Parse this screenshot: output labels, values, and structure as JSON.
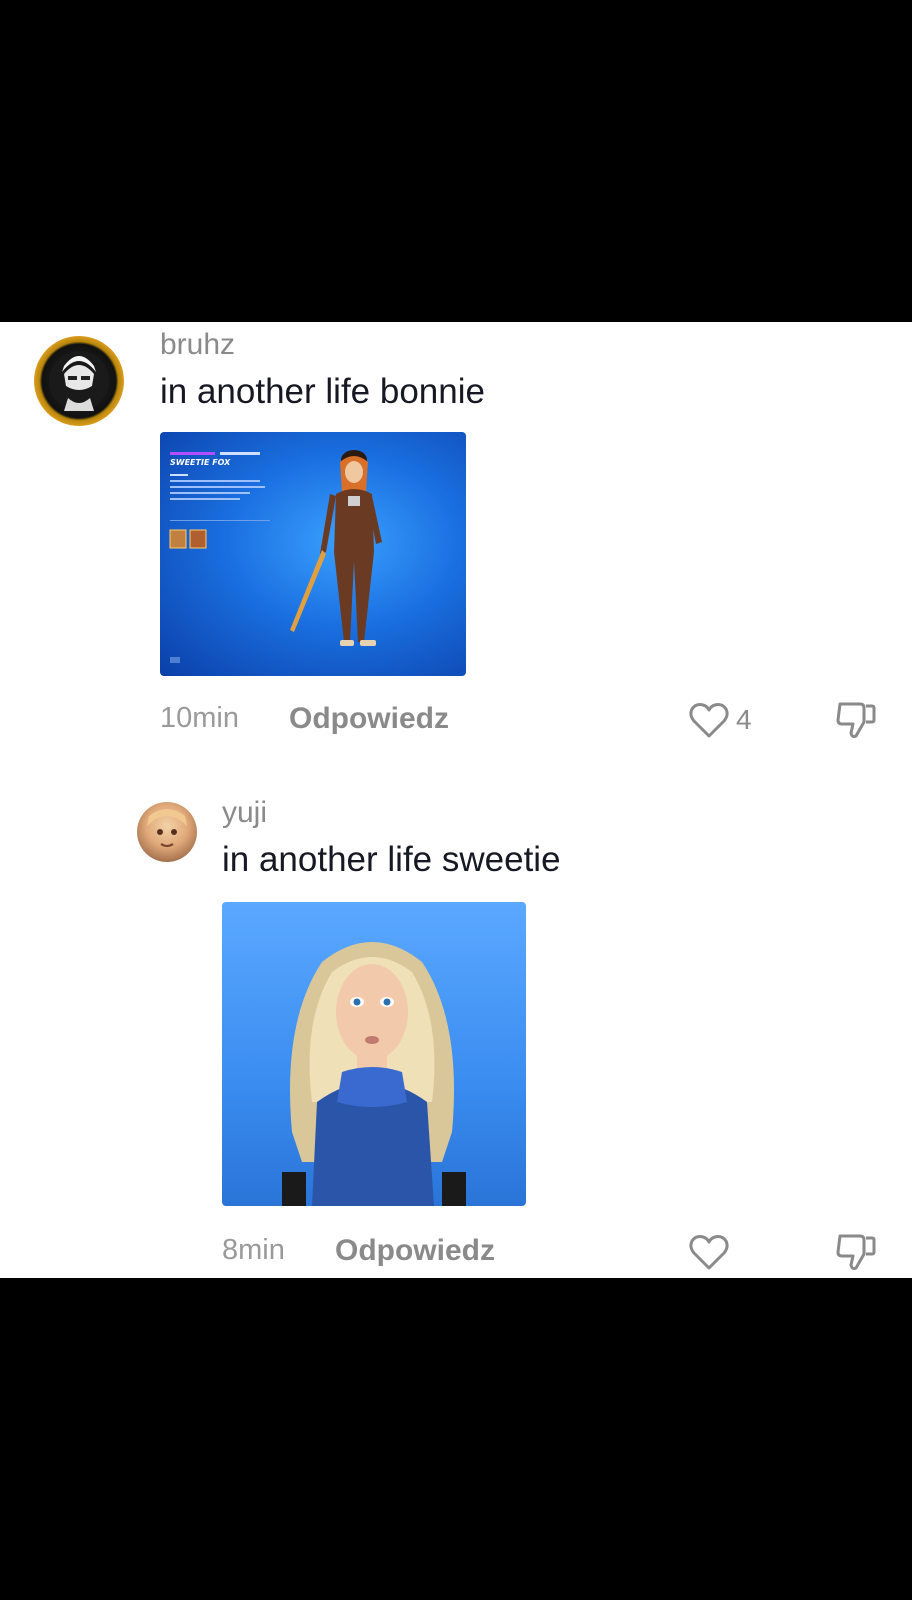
{
  "comments": [
    {
      "username": "bruhz",
      "text": "in another life bonnie",
      "time": "10min",
      "reply_label": "Odpowiedz",
      "like_count": "4",
      "media_title": "SWEETIE FOX",
      "avatar_icon": "anime-character-avatar"
    },
    {
      "username": "yuji",
      "text": "in another life sweetie",
      "time": "8min",
      "reply_label": "Odpowiedz",
      "like_count": "",
      "avatar_icon": "anime-character-avatar"
    }
  ],
  "colors": {
    "background": "#000000",
    "panel": "#ffffff",
    "muted_text": "#8a8a8a",
    "primary_text": "#161823"
  }
}
